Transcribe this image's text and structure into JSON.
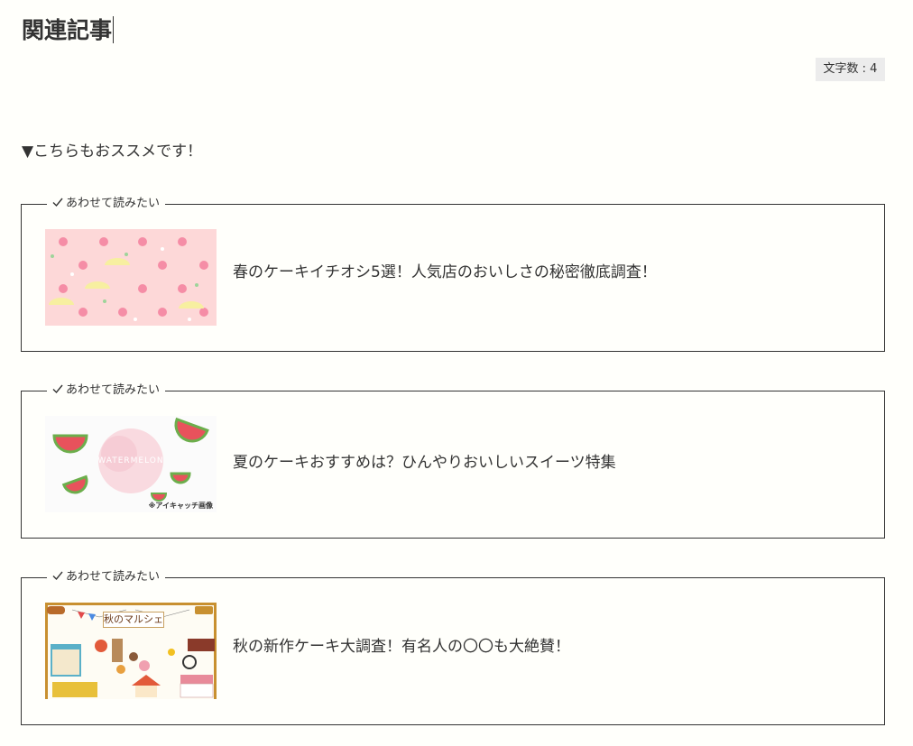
{
  "editor": {
    "title": "関連記事",
    "char_count_label": "文字数 : 4"
  },
  "recommend_text": "▼こちらもおススメです！",
  "cards": [
    {
      "label": "あわせて読みたい",
      "title": "春のケーキイチオシ5選！人気店のおいしさの秘密徹底調査！",
      "thumbnail_icon": "spring-flower-pattern"
    },
    {
      "label": "あわせて読みたい",
      "title": "夏のケーキおすすめは？ひんやりおいしいスイーツ特集",
      "thumbnail_icon": "watermelon-pattern",
      "thumbnail_center_text": "WATERMELON",
      "thumbnail_caption": "※アイキャッチ画像"
    },
    {
      "label": "あわせて読みたい",
      "title": "秋の新作ケーキ大調査！有名人の〇〇も大絶賛！",
      "thumbnail_icon": "autumn-market-illustration",
      "thumbnail_center_text": "秋のマルシェ"
    }
  ],
  "colors": {
    "background": "#fffffb",
    "text": "#333333",
    "badge_bg": "#ececec",
    "spring_bg": "#fdd8d8",
    "summer_bg": "#fbfbfb",
    "autumn_bg": "#fefcf4"
  }
}
